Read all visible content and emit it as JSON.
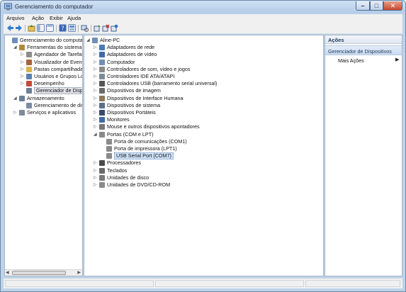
{
  "window": {
    "title": "Gerenciamento do computador"
  },
  "menu": [
    "Arquivo",
    "Ação",
    "Exibir",
    "Ajuda"
  ],
  "toolbar_icons": [
    "back-arrow-icon",
    "forward-arrow-icon",
    "up-folder-icon",
    "show-hide-tree-icon",
    "properties-icon",
    "help-icon",
    "console-view-icon",
    "device-scan-icon",
    "update-driver-icon",
    "uninstall-icon",
    "disable-device-icon"
  ],
  "left_tree": [
    {
      "label": "Gerenciamento do computad",
      "indent": 0,
      "expander": "",
      "icon": "computer-management-icon",
      "color": "#6f8fb6"
    },
    {
      "label": "Ferramentas do sistema",
      "indent": 1,
      "expander": "◢",
      "icon": "tools-icon",
      "color": "#b08a3c"
    },
    {
      "label": "Agendador de Tarefas",
      "indent": 2,
      "expander": "▷",
      "icon": "clock-icon",
      "color": "#8c8c8c"
    },
    {
      "label": "Visualizador de Eventos",
      "indent": 2,
      "expander": "▷",
      "icon": "event-viewer-icon",
      "color": "#a6633a"
    },
    {
      "label": "Pastas compartilhadas",
      "indent": 2,
      "expander": "▷",
      "icon": "shared-folder-icon",
      "color": "#d9b44a"
    },
    {
      "label": "Usuários e Grupos Loca",
      "indent": 2,
      "expander": "▷",
      "icon": "users-icon",
      "color": "#5a7fb0"
    },
    {
      "label": "Desempenho",
      "indent": 2,
      "expander": "▷",
      "icon": "performance-icon",
      "color": "#c44a3a"
    },
    {
      "label": "Gerenciador de Disposit",
      "indent": 2,
      "expander": "",
      "icon": "device-manager-icon",
      "color": "#6d7f96",
      "selected": true
    },
    {
      "label": "Armazenamento",
      "indent": 1,
      "expander": "◢",
      "icon": "storage-icon",
      "color": "#6a7f9a"
    },
    {
      "label": "Gerenciamento de disco",
      "indent": 2,
      "expander": "",
      "icon": "disk-icon",
      "color": "#7a8aa0"
    },
    {
      "label": "Serviços e aplicativos",
      "indent": 1,
      "expander": "▷",
      "icon": "services-icon",
      "color": "#7d8a9a"
    }
  ],
  "device_tree": [
    {
      "label": "Aline-PC",
      "indent": 0,
      "expander": "◢",
      "icon": "computer-icon",
      "color": "#6f8fb6"
    },
    {
      "label": "Adaptadores de rede",
      "indent": 1,
      "expander": "▷",
      "icon": "network-adapter-icon",
      "color": "#4a7ab8"
    },
    {
      "label": "Adaptadores de vídeo",
      "indent": 1,
      "expander": "▷",
      "icon": "display-adapter-icon",
      "color": "#3f6aa8"
    },
    {
      "label": "Computador",
      "indent": 1,
      "expander": "▷",
      "icon": "computer-icon",
      "color": "#6f8fb6"
    },
    {
      "label": "Controladores de som, vídeo e jogos",
      "indent": 1,
      "expander": "▷",
      "icon": "sound-icon",
      "color": "#8a8a8a"
    },
    {
      "label": "Controladores IDE ATA/ATAPI",
      "indent": 1,
      "expander": "▷",
      "icon": "ide-controller-icon",
      "color": "#7b8b9b"
    },
    {
      "label": "Controladores USB (barramento serial universal)",
      "indent": 1,
      "expander": "▷",
      "icon": "usb-icon",
      "color": "#555555"
    },
    {
      "label": "Dispositivos de imagem",
      "indent": 1,
      "expander": "▷",
      "icon": "camera-icon",
      "color": "#6b6b6b"
    },
    {
      "label": "Dispositivos de Interface Humana",
      "indent": 1,
      "expander": "▷",
      "icon": "hid-icon",
      "color": "#8c7a5a"
    },
    {
      "label": "Dispositivos de sistema",
      "indent": 1,
      "expander": "▷",
      "icon": "system-device-icon",
      "color": "#5a6f8a"
    },
    {
      "label": "Dispositivos Portáteis",
      "indent": 1,
      "expander": "▷",
      "icon": "portable-device-icon",
      "color": "#3a4a6a"
    },
    {
      "label": "Monitores",
      "indent": 1,
      "expander": "▷",
      "icon": "monitor-icon",
      "color": "#3f6aa8"
    },
    {
      "label": "Mouse e outros dispositivos apontadores",
      "indent": 1,
      "expander": "▷",
      "icon": "mouse-icon",
      "color": "#777777"
    },
    {
      "label": "Portas (COM e LPT)",
      "indent": 1,
      "expander": "◢",
      "icon": "port-icon",
      "color": "#8a8a8a"
    },
    {
      "label": "Porta de comunicações (COM1)",
      "indent": 2,
      "expander": "",
      "icon": "port-icon",
      "color": "#8a8a8a"
    },
    {
      "label": "Porta de impressora (LPT1)",
      "indent": 2,
      "expander": "",
      "icon": "port-icon",
      "color": "#8a8a8a"
    },
    {
      "label": "USB Serial Port (COM7)",
      "indent": 2,
      "expander": "",
      "icon": "port-icon",
      "color": "#8a8a8a",
      "selected": true
    },
    {
      "label": "Processadores",
      "indent": 1,
      "expander": "▷",
      "icon": "processor-icon",
      "color": "#4a4a4a"
    },
    {
      "label": "Teclados",
      "indent": 1,
      "expander": "▷",
      "icon": "keyboard-icon",
      "color": "#6a6a6a"
    },
    {
      "label": "Unidades de disco",
      "indent": 1,
      "expander": "▷",
      "icon": "disk-drive-icon",
      "color": "#7a7a7a"
    },
    {
      "label": "Unidades de DVD/CD-ROM",
      "indent": 1,
      "expander": "▷",
      "icon": "dvd-icon",
      "color": "#8a8a8a"
    }
  ],
  "actions": {
    "title": "Ações",
    "section": "Gerenciador de Dispositivos",
    "items": [
      "Mais Ações"
    ]
  }
}
